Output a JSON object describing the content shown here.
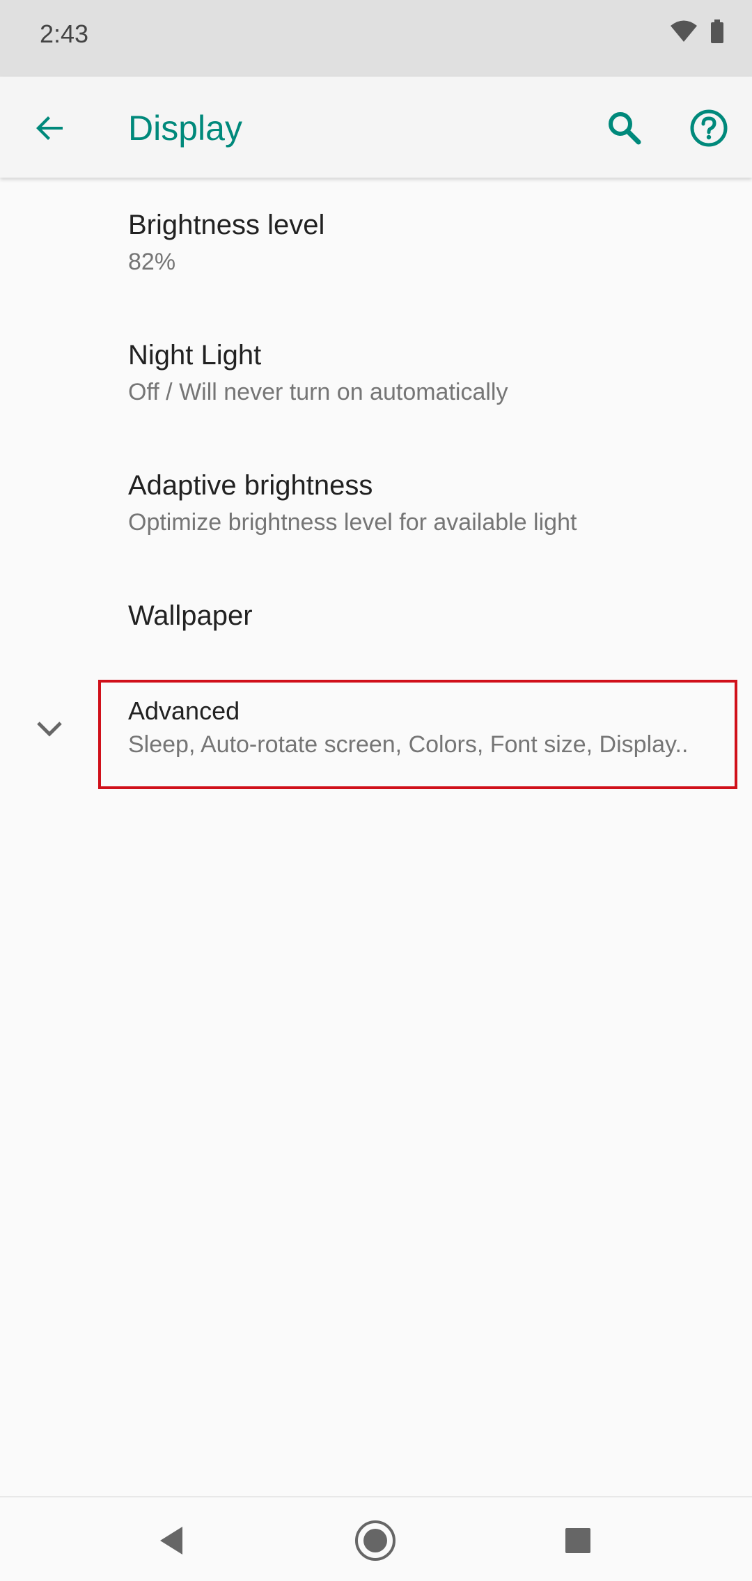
{
  "status_bar": {
    "time": "2:43",
    "icons": [
      "wifi-icon",
      "battery-icon"
    ]
  },
  "app_bar": {
    "title": "Display",
    "accent_color": "#00897b",
    "actions": [
      "back-arrow-icon",
      "search-icon",
      "help-icon"
    ]
  },
  "settings": [
    {
      "title": "Brightness level",
      "summary": "82%"
    },
    {
      "title": "Night Light",
      "summary": "Off / Will never turn on automatically"
    },
    {
      "title": "Adaptive brightness",
      "summary": "Optimize brightness level for available light"
    },
    {
      "title": "Wallpaper",
      "summary": ""
    },
    {
      "title": "Advanced",
      "summary": "Sleep, Auto-rotate screen, Colors, Font size, Display.."
    }
  ],
  "highlight_color": "#d0101a",
  "nav_bar": {
    "buttons": [
      "back-triangle-icon",
      "home-circle-icon",
      "recents-square-icon"
    ]
  }
}
